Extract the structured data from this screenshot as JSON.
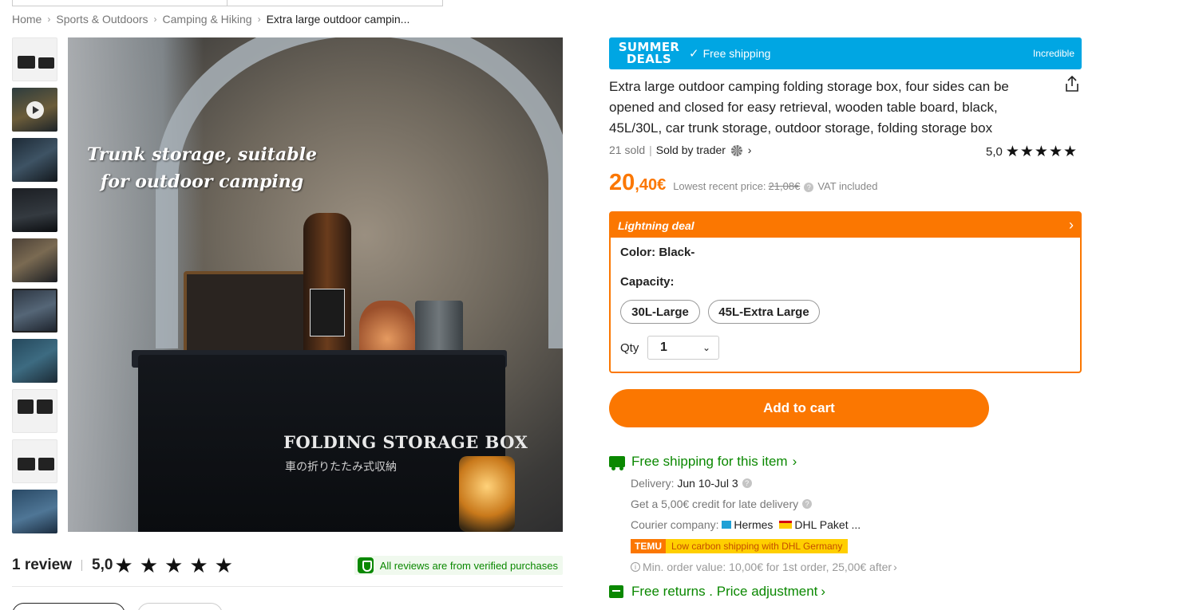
{
  "breadcrumb": {
    "items": [
      "Home",
      "Sports & Outdoors",
      "Camping & Hiking"
    ],
    "current": "Extra large outdoor campin..."
  },
  "gallery": {
    "thumbnails": [
      "product-info",
      "video",
      "photo",
      "photo",
      "photo",
      "photo-selected",
      "photo",
      "product-info",
      "product-info",
      "photo"
    ],
    "main_overlay_text": "Trunk storage, suitable for outdoor camping",
    "box_label": "FOLDING  STORAGE BOX",
    "box_sublabel": "車の折りたたみ式収納"
  },
  "reviews": {
    "count_label": "1 review",
    "score": "5,0",
    "verified_text": "All reviews are from verified purchases"
  },
  "deal_banner": {
    "logo_line1": "SUMMER",
    "logo_line2": "DEALS",
    "shipping": "Free shipping",
    "tag": "Incredible",
    "color": "#00a6e3"
  },
  "product": {
    "title": "Extra large outdoor camping folding storage box, four sides can be opened and closed for easy retrieval, wooden table board, black, 45L/30L, car trunk storage, outdoor storage, folding storage box",
    "sold": "21 sold",
    "sold_by": "Sold by trader",
    "rating": "5,0",
    "price_main": "20",
    "price_cents": ",40€",
    "lowest_label": "Lowest recent price:",
    "old_price": "21,08€",
    "vat": "VAT included"
  },
  "options": {
    "lightning_label": "Lightning deal",
    "color_label": "Color: Black-",
    "capacity_label": "Capacity:",
    "capacities": [
      "30L-Large",
      "45L-Extra Large"
    ],
    "qty_label": "Qty",
    "qty_value": "1"
  },
  "cart": {
    "add_label": "Add to cart"
  },
  "shipping": {
    "headline": "Free shipping for this item",
    "delivery_label": "Delivery:",
    "delivery_value": "Jun 10-Jul 3",
    "credit": "Get a 5,00€ credit for late delivery",
    "courier_label": "Courier company:",
    "courier1": "Hermes",
    "courier2": "DHL Paket ...",
    "temu_logo": "TEMU",
    "temu_text": "Low carbon shipping with DHL Germany",
    "min_order": "Min. order value: 10,00€ for 1st order, 25,00€ after",
    "returns": "Free returns . Price adjustment"
  },
  "colors": {
    "accent": "#fb7701",
    "green": "#0a8800",
    "banner": "#00a6e3"
  }
}
